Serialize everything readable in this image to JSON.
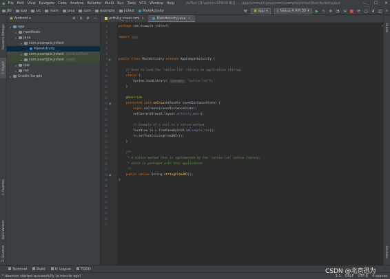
{
  "menubar": {
    "items": [
      "File",
      "Edit",
      "View",
      "Navigate",
      "Code",
      "Analyze",
      "Refactor",
      "Build",
      "Run",
      "Tools",
      "VCS",
      "Window",
      "Help"
    ],
    "title": "JniTest [D:\\admin\\SPROUND] - ...\\app\\src\\main\\java\\com\\example\\jnitest\\MainActivity.java"
  },
  "navbar": {
    "crumbs": [
      "JNI",
      "app",
      "src",
      "main",
      "java",
      "com",
      "example",
      "jnitest",
      "MainActivity"
    ],
    "run_config": "app",
    "device": "Nexus 4 API 30"
  },
  "left_stripe": {
    "tabs": [
      "Resource Manager",
      "1: Project",
      "2: Favorites",
      "Build Variants",
      "Z: Structure"
    ]
  },
  "right_stripe": {
    "tabs": [
      "Gradle",
      "Emulator"
    ]
  },
  "project": {
    "view": "Android",
    "tree": [
      {
        "label": "app",
        "indent": 0,
        "arrow": "▾",
        "icon": "mod"
      },
      {
        "label": "manifests",
        "indent": 1,
        "arrow": "▸",
        "icon": "folder"
      },
      {
        "label": "java",
        "indent": 1,
        "arrow": "▾",
        "icon": "folder"
      },
      {
        "label": "com.example.jnitest",
        "indent": 2,
        "arrow": "▾",
        "icon": "pkg"
      },
      {
        "label": "MainActivity",
        "indent": 3,
        "arrow": "",
        "icon": "cls",
        "selected": true
      },
      {
        "label": "com.example.jnitest",
        "indent": 2,
        "arrow": "▸",
        "icon": "pkg",
        "hint": "(androidTest)",
        "highlight": true
      },
      {
        "label": "com.example.jnitest",
        "indent": 2,
        "arrow": "▸",
        "icon": "pkg",
        "hint": "(test)",
        "highlight": true
      },
      {
        "label": "cpp",
        "indent": 1,
        "arrow": "▸",
        "icon": "folder"
      },
      {
        "label": "res",
        "indent": 1,
        "arrow": "▸",
        "icon": "folder"
      },
      {
        "label": "Gradle Scripts",
        "indent": 0,
        "arrow": "▸",
        "icon": "folder"
      }
    ]
  },
  "editor": {
    "tabs": [
      {
        "label": "activity_main.xml",
        "kind": "xml",
        "active": false
      },
      {
        "label": "MainActivity.java",
        "kind": "cls",
        "active": true
      }
    ],
    "line_count": 37,
    "lines": [
      {
        "n": 1,
        "html": "<span class='kw'>package</span> com.example.jnitest;"
      },
      {
        "n": 3,
        "html": "<span class='kw'>import</span> <span class='fold'>...</span>"
      },
      {
        "n": 7,
        "html": "<span class='kw'>public class</span> MainActivity <span class='kw'>extends</span> AppCompatActivity {"
      },
      {
        "n": 9,
        "html": "    <span class='cm'>// Used to load the 'native-lib' library on application startup.</span>"
      },
      {
        "n": 10,
        "html": "    <span class='kw'>static</span> {"
      },
      {
        "n": 11,
        "html": "        System.<i>loadLibrary</i>( <span class='hintbox'>libname:</span> <span class='str'>\"native-lib\"</span>);"
      },
      {
        "n": 12,
        "html": "    }"
      },
      {
        "n": 14,
        "html": "    <span class='ann'>@Override</span>"
      },
      {
        "n": 15,
        "html": "    <span class='kw'>protected void</span> <span class='fn'>onCreate</span>(Bundle savedInstanceState) {"
      },
      {
        "n": 16,
        "html": "        <span class='kw'>super</span>.onCreate(savedInstanceState);"
      },
      {
        "n": 17,
        "html": "        setContentView(R.layout.<span class='fld'>activity_main</span>);"
      },
      {
        "n": 19,
        "html": "        <span class='cm'>// Example of a call to a native method</span>"
      },
      {
        "n": 20,
        "html": "        TextView tv = findViewById(R.id.<span class='fld'>sample_text</span>);"
      },
      {
        "n": 21,
        "html": "        tv.setText(stringFromJNI());"
      },
      {
        "n": 22,
        "html": "    }"
      },
      {
        "n": 24,
        "html": "    <span class='dc'>/**</span>"
      },
      {
        "n": 25,
        "html": "    <span class='dc'> * A native method that is implemented by the 'native-lib' native library,</span>"
      },
      {
        "n": 26,
        "html": "    <span class='dc'> * which is packaged with this application.</span>"
      },
      {
        "n": 27,
        "html": "    <span class='dc'> */</span>"
      },
      {
        "n": 28,
        "html": "    <span class='kw'>public native</span> String <span class='fn'>stringFromJNI</span>();"
      },
      {
        "n": 29,
        "html": "}"
      }
    ]
  },
  "toolwindows": [
    "Terminal",
    "Build",
    "6: Logcat",
    "TODO"
  ],
  "status": {
    "message": "* daemon started successfully (a minute ago)",
    "right": [
      "1:1",
      "CRLF",
      "UTF-8",
      "4 spaces"
    ]
  },
  "watermark": "CSDN @北京迅为"
}
